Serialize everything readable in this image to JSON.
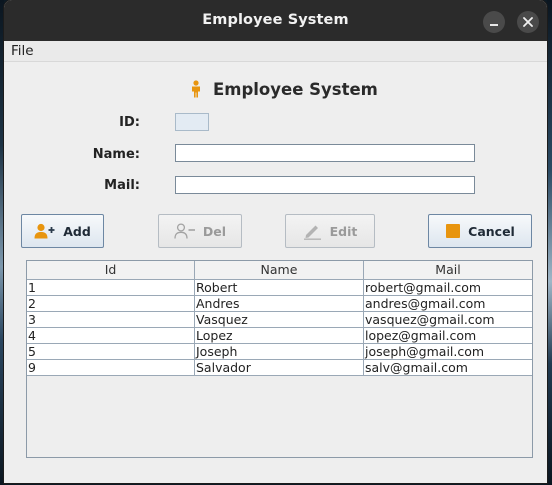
{
  "window": {
    "title": "Employee System",
    "controls": [
      "minimize-icon",
      "close-icon"
    ]
  },
  "menubar": {
    "file_label": "File"
  },
  "form": {
    "heading": "Employee System",
    "heading_icon": "person-icon",
    "id_label": "ID:",
    "name_label": "Name:",
    "mail_label": "Mail:",
    "id_value": "",
    "name_value": "",
    "mail_value": ""
  },
  "toolbar": {
    "add_label": "Add",
    "add_icon": "add-user-icon",
    "del_label": "Del",
    "del_icon": "remove-user-icon",
    "edit_label": "Edit",
    "edit_icon": "pencil-icon",
    "cancel_label": "Cancel",
    "cancel_icon": "stop-icon"
  },
  "colors": {
    "accent": "#e8950f",
    "titlebar": "#2b2b2b",
    "button_border": "#6d87a3"
  },
  "table": {
    "columns": [
      "Id",
      "Name",
      "Mail"
    ],
    "rows": [
      [
        "1",
        "Robert",
        "robert@gmail.com"
      ],
      [
        "2",
        "Andres",
        "andres@gmail.com"
      ],
      [
        "3",
        "Vasquez",
        "vasquez@gmail.com"
      ],
      [
        "4",
        "Lopez",
        "lopez@gmail.com"
      ],
      [
        "5",
        "Joseph",
        "joseph@gmail.com"
      ],
      [
        "9",
        "Salvador",
        "salv@gmail.com"
      ]
    ]
  }
}
